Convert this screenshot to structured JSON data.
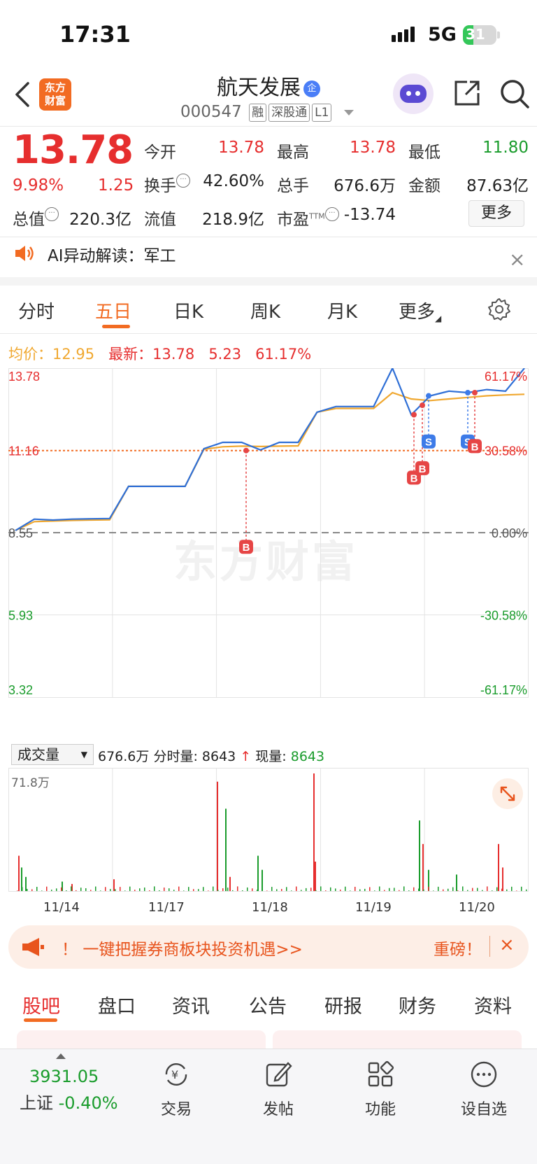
{
  "status_bar": {
    "time": "17:31",
    "network": "5G",
    "battery": "31",
    "battery_level": 0.31
  },
  "header": {
    "logo_line1": "东方",
    "logo_line2": "财富",
    "stock_name": "航天发展",
    "name_badge": "企",
    "code": "000547",
    "tags": [
      "融",
      "深股通",
      "L1"
    ]
  },
  "quote": {
    "price": "13.78",
    "change_pct": "9.98%",
    "change": "1.25",
    "open_label": "今开",
    "open": "13.78",
    "high_label": "最高",
    "high": "13.78",
    "low_label": "最低",
    "low": "11.80",
    "turnover_label": "换手",
    "turnover": "42.60%",
    "volume_label": "总手",
    "volume": "676.6万",
    "amount_label": "金额",
    "amount": "87.63亿",
    "mktcap_label": "总值",
    "mktcap": "220.3亿",
    "float_label": "流值",
    "float_cap": "218.9亿",
    "pe_label": "市盈",
    "pe_sup": "TTM",
    "pe": "-13.74",
    "more_button": "更多"
  },
  "ai_alert": {
    "text": "AI异动解读：军工",
    "close": "×"
  },
  "chart_tabs": [
    "分时",
    "五日",
    "日K",
    "周K",
    "月K",
    "更多"
  ],
  "chart_tabs_active": "五日",
  "avg_line": {
    "avg_label": "均价：",
    "avg": "12.95",
    "latest_label": "最新：",
    "latest": "13.78",
    "delta": "5.23",
    "delta_pct": "61.17%"
  },
  "chart_data": {
    "type": "line",
    "title": "",
    "days": [
      "11/14",
      "11/17",
      "11/18",
      "11/19",
      "11/20"
    ],
    "y_left_ticks": [
      "13.78",
      "11.16",
      "8.55",
      "5.93",
      "3.32"
    ],
    "y_right_ticks": [
      "61.17%",
      "30.58%",
      "0.00%",
      "-30.58%",
      "-61.17%"
    ],
    "ylim": [
      3.32,
      13.78
    ],
    "reference_price": 8.55,
    "reference_line": 11.16,
    "series": [
      {
        "name": "",
        "color": "#2f6fd6",
        "values": [
          8.62,
          8.98,
          8.95,
          8.98,
          8.99,
          9.0,
          10.02,
          10.02,
          10.02,
          10.02,
          11.22,
          11.42,
          11.42,
          11.18,
          11.42,
          11.42,
          12.38,
          12.56,
          12.56,
          12.56,
          13.78,
          12.3,
          12.9,
          13.05,
          13.0,
          13.1,
          13.05,
          13.78
        ]
      },
      {
        "name": "",
        "color": "#f0a830",
        "values": [
          8.62,
          8.9,
          8.92,
          8.94,
          8.95,
          8.96,
          10.02,
          10.02,
          10.02,
          10.02,
          11.2,
          11.28,
          11.3,
          11.29,
          11.3,
          11.31,
          12.38,
          12.5,
          12.5,
          12.5,
          13.0,
          12.8,
          12.75,
          12.8,
          12.85,
          12.9,
          12.93,
          12.95
        ]
      }
    ],
    "markers": [
      "B",
      "B",
      "B",
      "S",
      "S",
      "B"
    ],
    "watermark": "东方财富"
  },
  "volume": {
    "selector": "成交量",
    "total": "676.6万",
    "label_period": "分时量:",
    "period_value": "8643",
    "arrow": "↑",
    "label_now": "现量:",
    "now_value": "8643",
    "max_label": "71.8万"
  },
  "banner": {
    "bang": "！",
    "text": "一键把握券商板块投资机遇>>",
    "cta": "重磅！",
    "close": "×"
  },
  "bottom_tabs": [
    "股吧",
    "盘口",
    "资讯",
    "公告",
    "研报",
    "财务",
    "资料"
  ],
  "bottom_tabs_active": "股吧",
  "tabbar": {
    "index_value": "3931.05",
    "index_name": "上证",
    "index_change": "-0.40%",
    "items": [
      "交易",
      "发帖",
      "功能",
      "设自选"
    ]
  }
}
